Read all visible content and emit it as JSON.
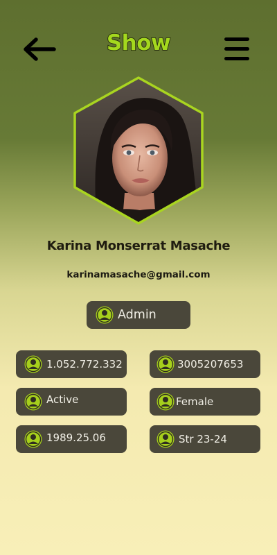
{
  "header": {
    "title": "Show",
    "back_icon": "arrow-left-icon",
    "menu_icon": "hamburger-menu-icon"
  },
  "profile": {
    "avatar_icon": "profile-photo",
    "name": "Karina Monserrat Masache",
    "email": "karinamasache@gmail.com",
    "role": "Admin"
  },
  "details": [
    {
      "label": "1.052.772.332",
      "icon": "user-icon"
    },
    {
      "label": "3005207653",
      "icon": "user-icon"
    },
    {
      "label": "Active",
      "icon": "user-icon"
    },
    {
      "label": "Female",
      "icon": "user-icon"
    },
    {
      "label": "1989.25.06",
      "icon": "user-icon"
    },
    {
      "label": "Str 23-24",
      "icon": "user-icon"
    }
  ],
  "colors": {
    "accent": "#a4d81e",
    "pill_bg": "#4a473a",
    "header_bg": "#5e6f2f",
    "page_bottom": "#f8efb8"
  }
}
